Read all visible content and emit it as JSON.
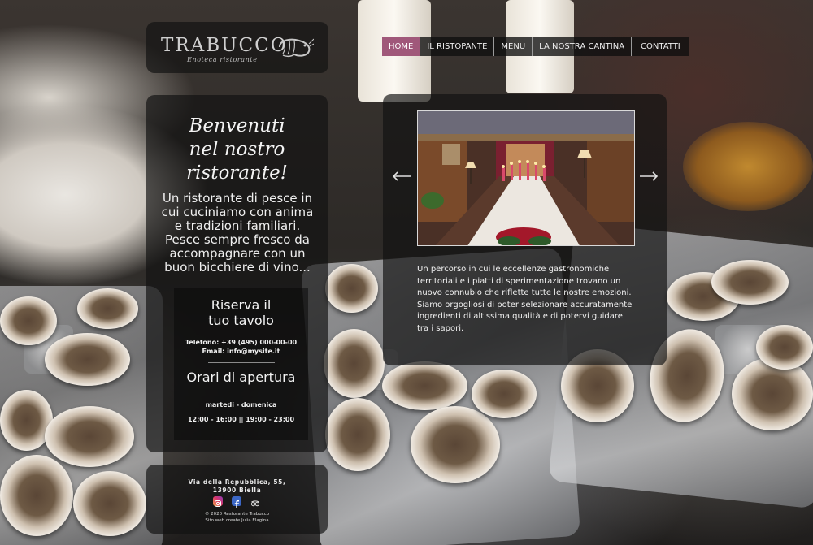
{
  "brand": {
    "name": "TRABUCCO",
    "subtitle": "Enoteca ristorante"
  },
  "nav": {
    "items": [
      {
        "label": "HOME",
        "active": true
      },
      {
        "label": "IL RISTOPANTE",
        "active": false
      },
      {
        "label": "MENU",
        "active": false
      },
      {
        "label": "LA NOSTRA CANTINA",
        "active": false
      },
      {
        "label": "CONTATTI",
        "active": false
      }
    ]
  },
  "welcome": {
    "title_line1": "Benvenuti",
    "title_line2": "nel nostro",
    "title_line3": "ristorante!",
    "text": "Un ristorante di pesce in cui cuciniamo con anima e tradizioni familiari. Pesce sempre fresco da accompagnare con un buon bicchiere di vino..."
  },
  "reservation": {
    "title_line1": "Riserva il",
    "title_line2": "tuo tavolo",
    "phone": "Telefono:  +39 (495) 000-00-00",
    "email": "Email:  info@mysite.it"
  },
  "hours": {
    "title": "Orari di apertura",
    "days": "martedi - domenica",
    "times": "12:00 - 16:00 || 19:00 - 23:00"
  },
  "footer": {
    "address_line1": "Via della Repubblica, 55,",
    "address_line2": "13900 Biella",
    "copyright": "© 2020 Restorante Trabucco",
    "credit": "Sito web create Julia Elagina",
    "social": [
      "instagram-icon",
      "facebook-icon",
      "tripadvisor-icon"
    ]
  },
  "main": {
    "description": "Un percorso in cui le eccellenze gastronomiche territoriali e i piatti di sperimentazione trovano un nuovo connubio che riflette tutte le nostre emozioni. Siamo orgogliosi di poter selezionare accuratamente ingredienti di altissima qualità e di potervi guidare tra i sapori."
  },
  "colors": {
    "accent": "#a0587a",
    "panel": "#121212"
  }
}
